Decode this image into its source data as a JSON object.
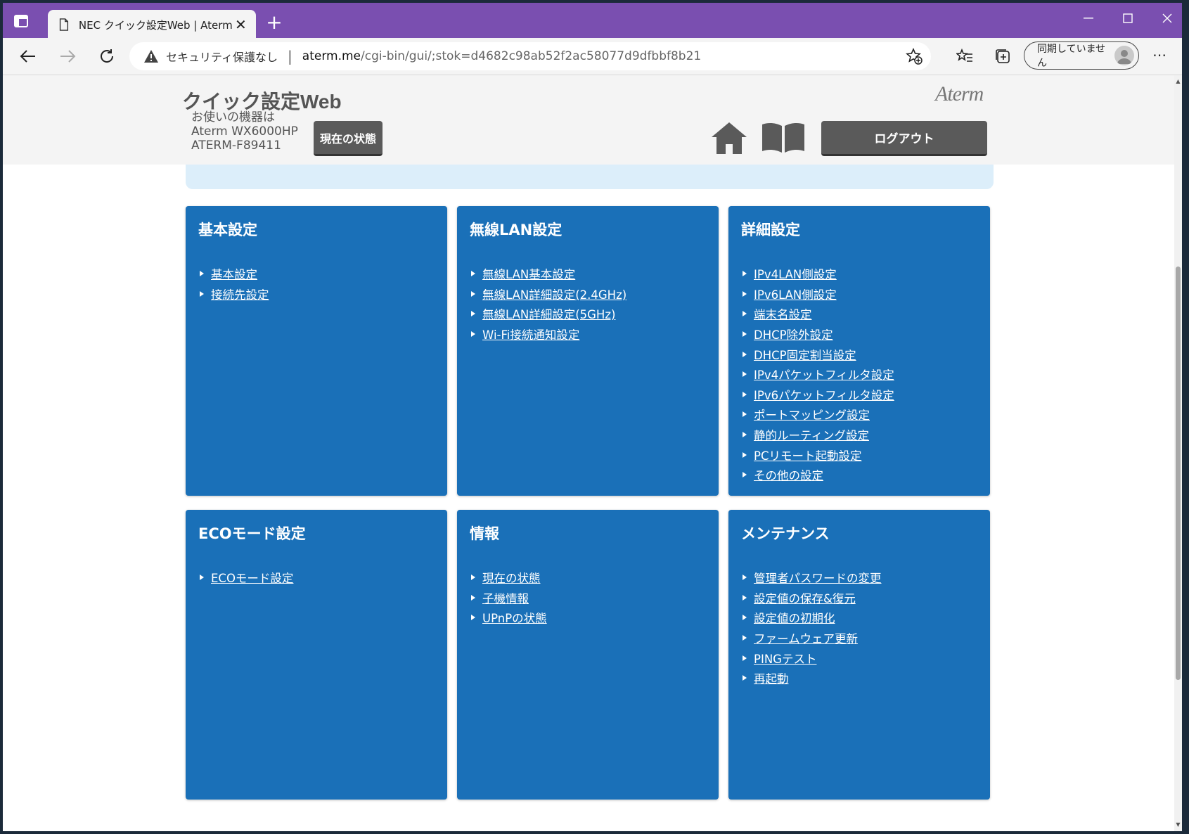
{
  "browser": {
    "tab_title": "NEC クイック設定Web | Aterm",
    "security_text": "セキュリティ保護なし",
    "url_host": "aterm.me",
    "url_path": "/cgi-bin/gui/;stok=d4682c98ab52f2ac58077d9dfbbf8b21",
    "profile_text": "同期していません",
    "accent_color": "#7a4fb0"
  },
  "header": {
    "site_title": "クイック設定Web",
    "device_line1": "お使いの機器は",
    "device_line2": "Aterm WX6000HP",
    "device_line3": "ATERM-F89411",
    "status_button": "現在の状態",
    "logo": "Aterm",
    "logout_button": "ログアウト"
  },
  "panels": [
    {
      "title": "基本設定",
      "items": [
        "基本設定",
        "接続先設定"
      ]
    },
    {
      "title": "無線LAN設定",
      "items": [
        "無線LAN基本設定",
        "無線LAN詳細設定(2.4GHz)",
        "無線LAN詳細設定(5GHz)",
        "Wi-Fi接続通知設定"
      ]
    },
    {
      "title": "詳細設定",
      "items": [
        "IPv4LAN側設定",
        "IPv6LAN側設定",
        "端末名設定",
        "DHCP除外設定",
        "DHCP固定割当設定",
        "IPv4パケットフィルタ設定",
        "IPv6パケットフィルタ設定",
        "ポートマッピング設定",
        "静的ルーティング設定",
        "PCリモート起動設定",
        "その他の設定"
      ]
    },
    {
      "title": "ECOモード設定",
      "items": [
        "ECOモード設定"
      ]
    },
    {
      "title": "情報",
      "items": [
        "現在の状態",
        "子機情報",
        "UPnPの状態"
      ]
    },
    {
      "title": "メンテナンス",
      "items": [
        "管理者パスワードの変更",
        "設定値の保存&復元",
        "設定値の初期化",
        "ファームウェア更新",
        "PINGテスト",
        "再起動"
      ]
    }
  ]
}
